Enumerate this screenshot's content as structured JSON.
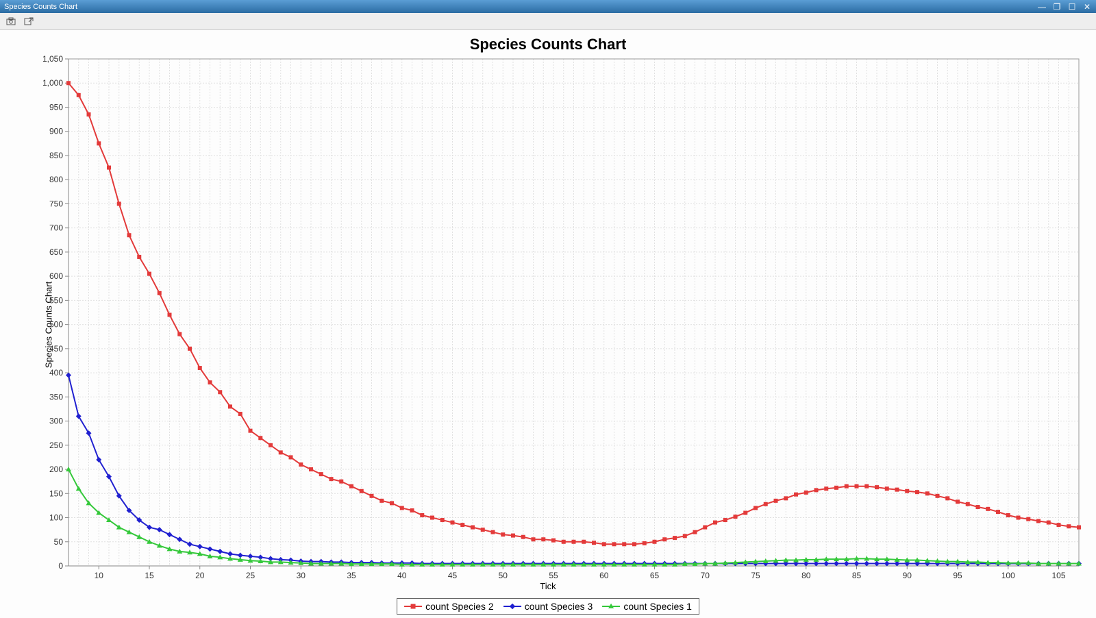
{
  "window": {
    "title": "Species Counts Chart"
  },
  "toolbar": {
    "tool1_name": "camera-icon",
    "tool2_name": "export-icon"
  },
  "chart_data": {
    "type": "line",
    "title": "Species Counts Chart",
    "xlabel": "Tick",
    "ylabel": "Species Counts Chart",
    "xlim": [
      7,
      107
    ],
    "ylim": [
      0,
      1050
    ],
    "x_ticks": [
      10,
      15,
      20,
      25,
      30,
      35,
      40,
      45,
      50,
      55,
      60,
      65,
      70,
      75,
      80,
      85,
      90,
      95,
      100,
      105
    ],
    "y_ticks": [
      0,
      50,
      100,
      150,
      200,
      250,
      300,
      350,
      400,
      450,
      500,
      550,
      600,
      650,
      700,
      750,
      800,
      850,
      900,
      950,
      1000,
      1050
    ],
    "y_tick_labels": [
      "0",
      "50",
      "100",
      "150",
      "200",
      "250",
      "300",
      "350",
      "400",
      "450",
      "500",
      "550",
      "600",
      "650",
      "700",
      "750",
      "800",
      "850",
      "900",
      "950",
      "1,000",
      "1,050"
    ],
    "x": [
      7,
      8,
      9,
      10,
      11,
      12,
      13,
      14,
      15,
      16,
      17,
      18,
      19,
      20,
      21,
      22,
      23,
      24,
      25,
      26,
      27,
      28,
      29,
      30,
      31,
      32,
      33,
      34,
      35,
      36,
      37,
      38,
      39,
      40,
      41,
      42,
      43,
      44,
      45,
      46,
      47,
      48,
      49,
      50,
      51,
      52,
      53,
      54,
      55,
      56,
      57,
      58,
      59,
      60,
      61,
      62,
      63,
      64,
      65,
      66,
      67,
      68,
      69,
      70,
      71,
      72,
      73,
      74,
      75,
      76,
      77,
      78,
      79,
      80,
      81,
      82,
      83,
      84,
      85,
      86,
      87,
      88,
      89,
      90,
      91,
      92,
      93,
      94,
      95,
      96,
      97,
      98,
      99,
      100,
      101,
      102,
      103,
      104,
      105,
      106,
      107
    ],
    "series": [
      {
        "name": "count Species 2",
        "color": "#e33a3a",
        "marker": "square",
        "values": [
          1000,
          975,
          935,
          875,
          825,
          750,
          685,
          640,
          605,
          565,
          520,
          480,
          450,
          410,
          380,
          360,
          330,
          315,
          280,
          265,
          250,
          235,
          225,
          210,
          200,
          190,
          180,
          175,
          165,
          155,
          145,
          135,
          130,
          120,
          115,
          105,
          100,
          95,
          90,
          85,
          80,
          75,
          70,
          65,
          63,
          60,
          55,
          55,
          53,
          50,
          50,
          50,
          48,
          45,
          45,
          45,
          45,
          47,
          50,
          55,
          58,
          62,
          70,
          80,
          90,
          95,
          102,
          110,
          120,
          128,
          135,
          140,
          148,
          152,
          157,
          160,
          162,
          165,
          165,
          165,
          163,
          160,
          158,
          155,
          153,
          150,
          145,
          140,
          133,
          128,
          122,
          118,
          112,
          105,
          100,
          97,
          93,
          90,
          85,
          82,
          80
        ]
      },
      {
        "name": "count Species 3",
        "color": "#2020d0",
        "marker": "diamond",
        "values": [
          395,
          310,
          275,
          220,
          185,
          145,
          115,
          95,
          80,
          75,
          65,
          55,
          45,
          40,
          35,
          30,
          25,
          22,
          20,
          18,
          15,
          13,
          12,
          10,
          9,
          9,
          8,
          8,
          7,
          7,
          7,
          6,
          6,
          6,
          6,
          5,
          5,
          5,
          5,
          5,
          5,
          5,
          5,
          5,
          5,
          5,
          5,
          5,
          5,
          5,
          5,
          5,
          5,
          5,
          5,
          5,
          5,
          5,
          5,
          5,
          5,
          5,
          5,
          5,
          5,
          5,
          5,
          5,
          5,
          5,
          5,
          5,
          5,
          5,
          5,
          5,
          5,
          5,
          5,
          5,
          5,
          5,
          5,
          5,
          5,
          5,
          5,
          5,
          5,
          5,
          5,
          5,
          5,
          5,
          5,
          5,
          5,
          5,
          5,
          5,
          5
        ]
      },
      {
        "name": "count Species 1",
        "color": "#34c83a",
        "marker": "triangle",
        "values": [
          200,
          160,
          130,
          110,
          95,
          80,
          70,
          60,
          50,
          42,
          35,
          30,
          28,
          25,
          20,
          18,
          15,
          13,
          11,
          10,
          8,
          8,
          7,
          6,
          5,
          5,
          5,
          5,
          4,
          4,
          4,
          4,
          4,
          3,
          3,
          3,
          3,
          3,
          3,
          3,
          3,
          3,
          3,
          3,
          3,
          3,
          3,
          3,
          3,
          3,
          3,
          3,
          3,
          3,
          3,
          3,
          3,
          3,
          3,
          3,
          3,
          4,
          4,
          5,
          5,
          6,
          7,
          8,
          9,
          10,
          11,
          12,
          12,
          13,
          13,
          14,
          14,
          14,
          15,
          15,
          14,
          14,
          13,
          12,
          12,
          11,
          10,
          9,
          9,
          8,
          8,
          7,
          7,
          6,
          6,
          6,
          5,
          5,
          5,
          5,
          5
        ]
      }
    ],
    "legend": [
      "count Species 2",
      "count Species 3",
      "count Species 1"
    ]
  }
}
